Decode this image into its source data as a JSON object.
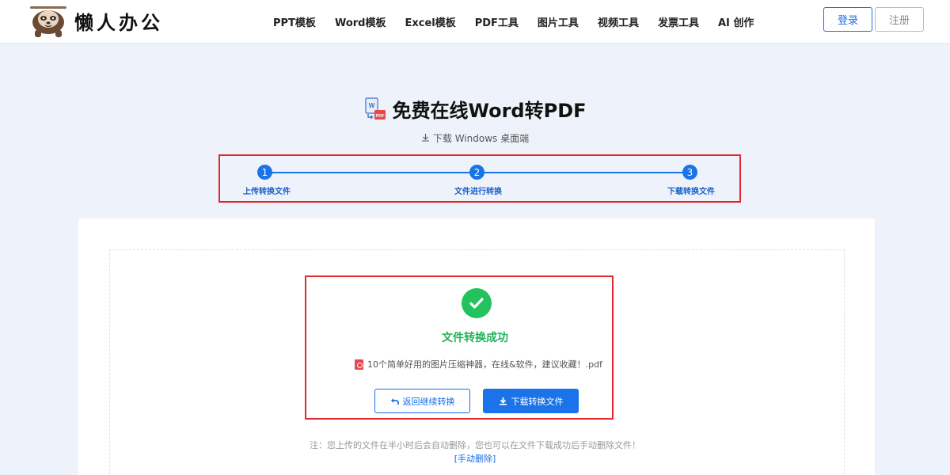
{
  "header": {
    "logo_text": "懒人办公",
    "nav": [
      "PPT模板",
      "Word模板",
      "Excel模板",
      "PDF工具",
      "图片工具",
      "视频工具",
      "发票工具",
      "AI 创作"
    ],
    "login_label": "登录",
    "register_label": "注册"
  },
  "main": {
    "title": "免费在线Word转PDF",
    "download_windows": "下载 Windows 桌面端",
    "steps": [
      {
        "number": "1",
        "label": "上传转换文件"
      },
      {
        "number": "2",
        "label": "文件进行转换"
      },
      {
        "number": "3",
        "label": "下载转换文件"
      }
    ],
    "success_text": "文件转换成功",
    "file_name": "10个简单好用的图片压缩神器，在线&软件，建议收藏！.pdf",
    "back_button": "返回继续转换",
    "download_button": "下载转换文件",
    "note": "注：您上传的文件在半小时后会自动删除，您也可以在文件下载成功后手动删除文件！",
    "delete_link": "[手动删除]"
  },
  "colors": {
    "accent": "#1a73e8",
    "success": "#22c35e",
    "highlight_border": "#e0282e"
  }
}
